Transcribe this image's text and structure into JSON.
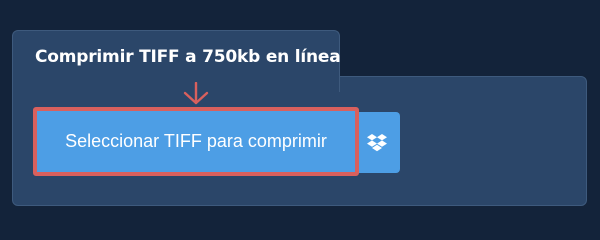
{
  "tab": {
    "title": "Comprimir TIFF a 750kb en línea"
  },
  "actions": {
    "upload_label": "Seleccionar TIFF para comprimir",
    "dropbox_icon": "dropbox-icon",
    "pointer_icon": "arrow-down-icon"
  },
  "colors": {
    "page_background": "#13233a",
    "panel_background": "#2b4669",
    "button_background": "#4d9ee5",
    "highlight": "#d9605d"
  }
}
